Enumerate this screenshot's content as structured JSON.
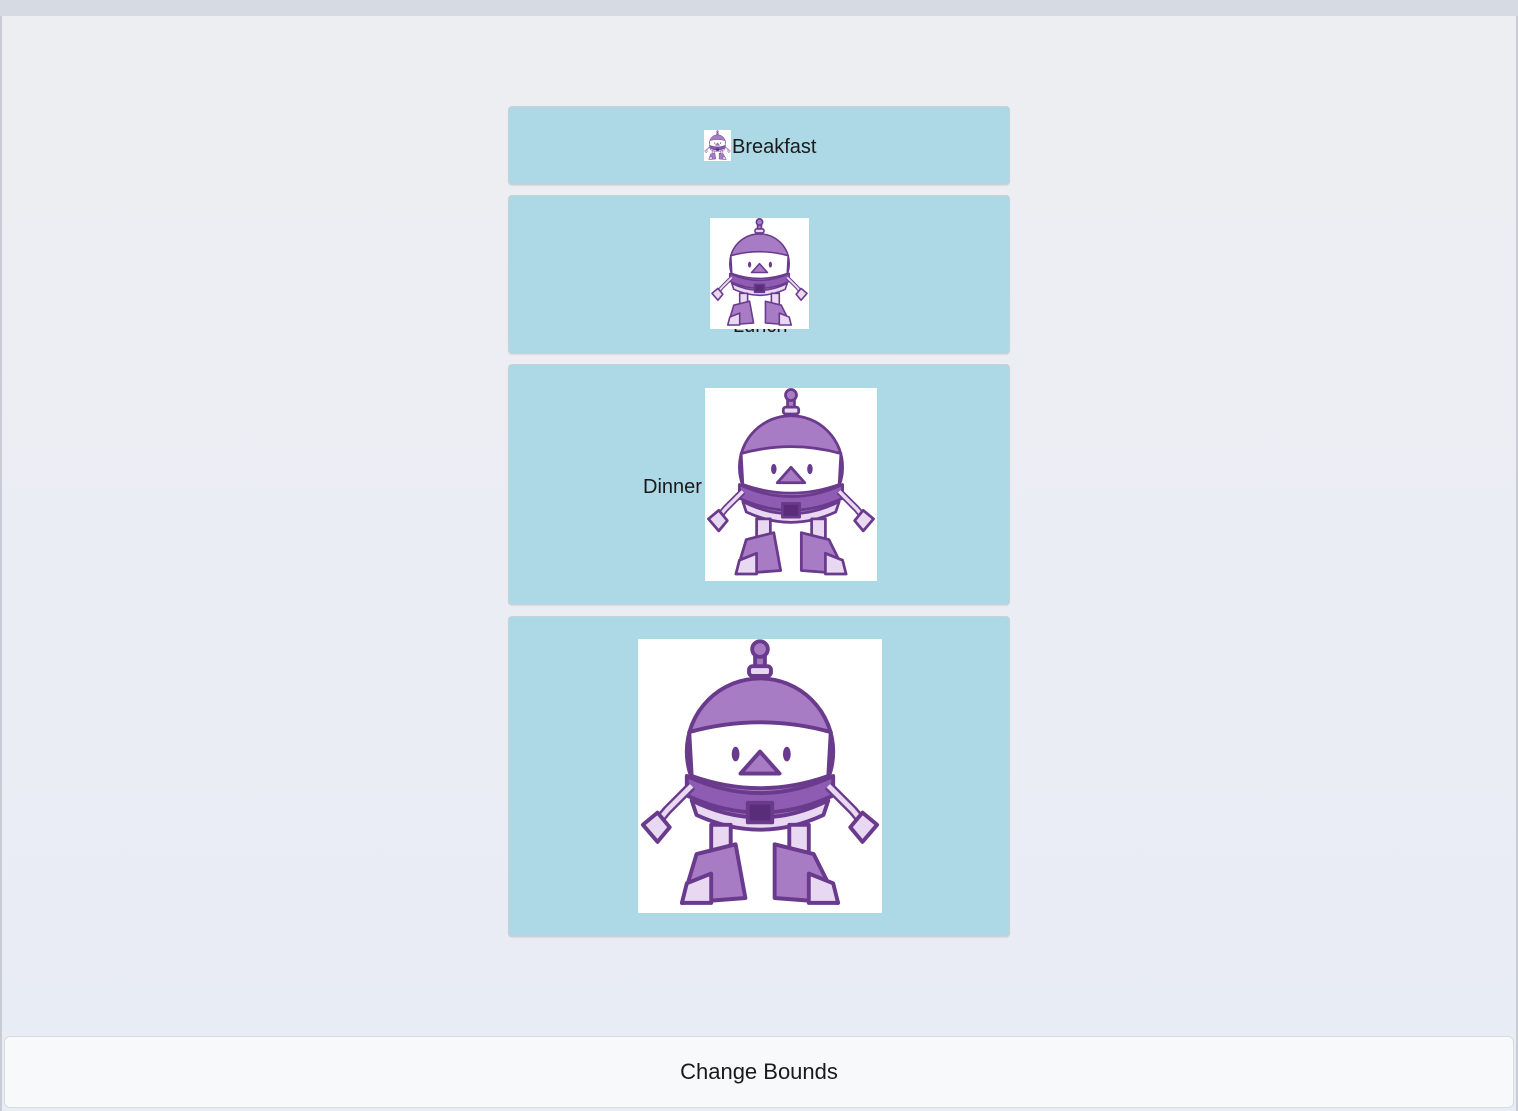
{
  "cards": [
    {
      "label": "Breakfast",
      "image_icon": "dotnet-bot-robot-icon"
    },
    {
      "label": "Lunch",
      "image_icon": "dotnet-bot-robot-icon"
    },
    {
      "label": "Dinner",
      "image_icon": "dotnet-bot-robot-icon"
    },
    {
      "label": "",
      "image_icon": "dotnet-bot-robot-icon"
    }
  ],
  "robot_badge": ".NET",
  "footer": {
    "button_label": "Change Bounds"
  },
  "colors": {
    "card_background": "#add8e6",
    "robot_purple": "#a77cc5",
    "robot_dark": "#6a3a8c"
  }
}
